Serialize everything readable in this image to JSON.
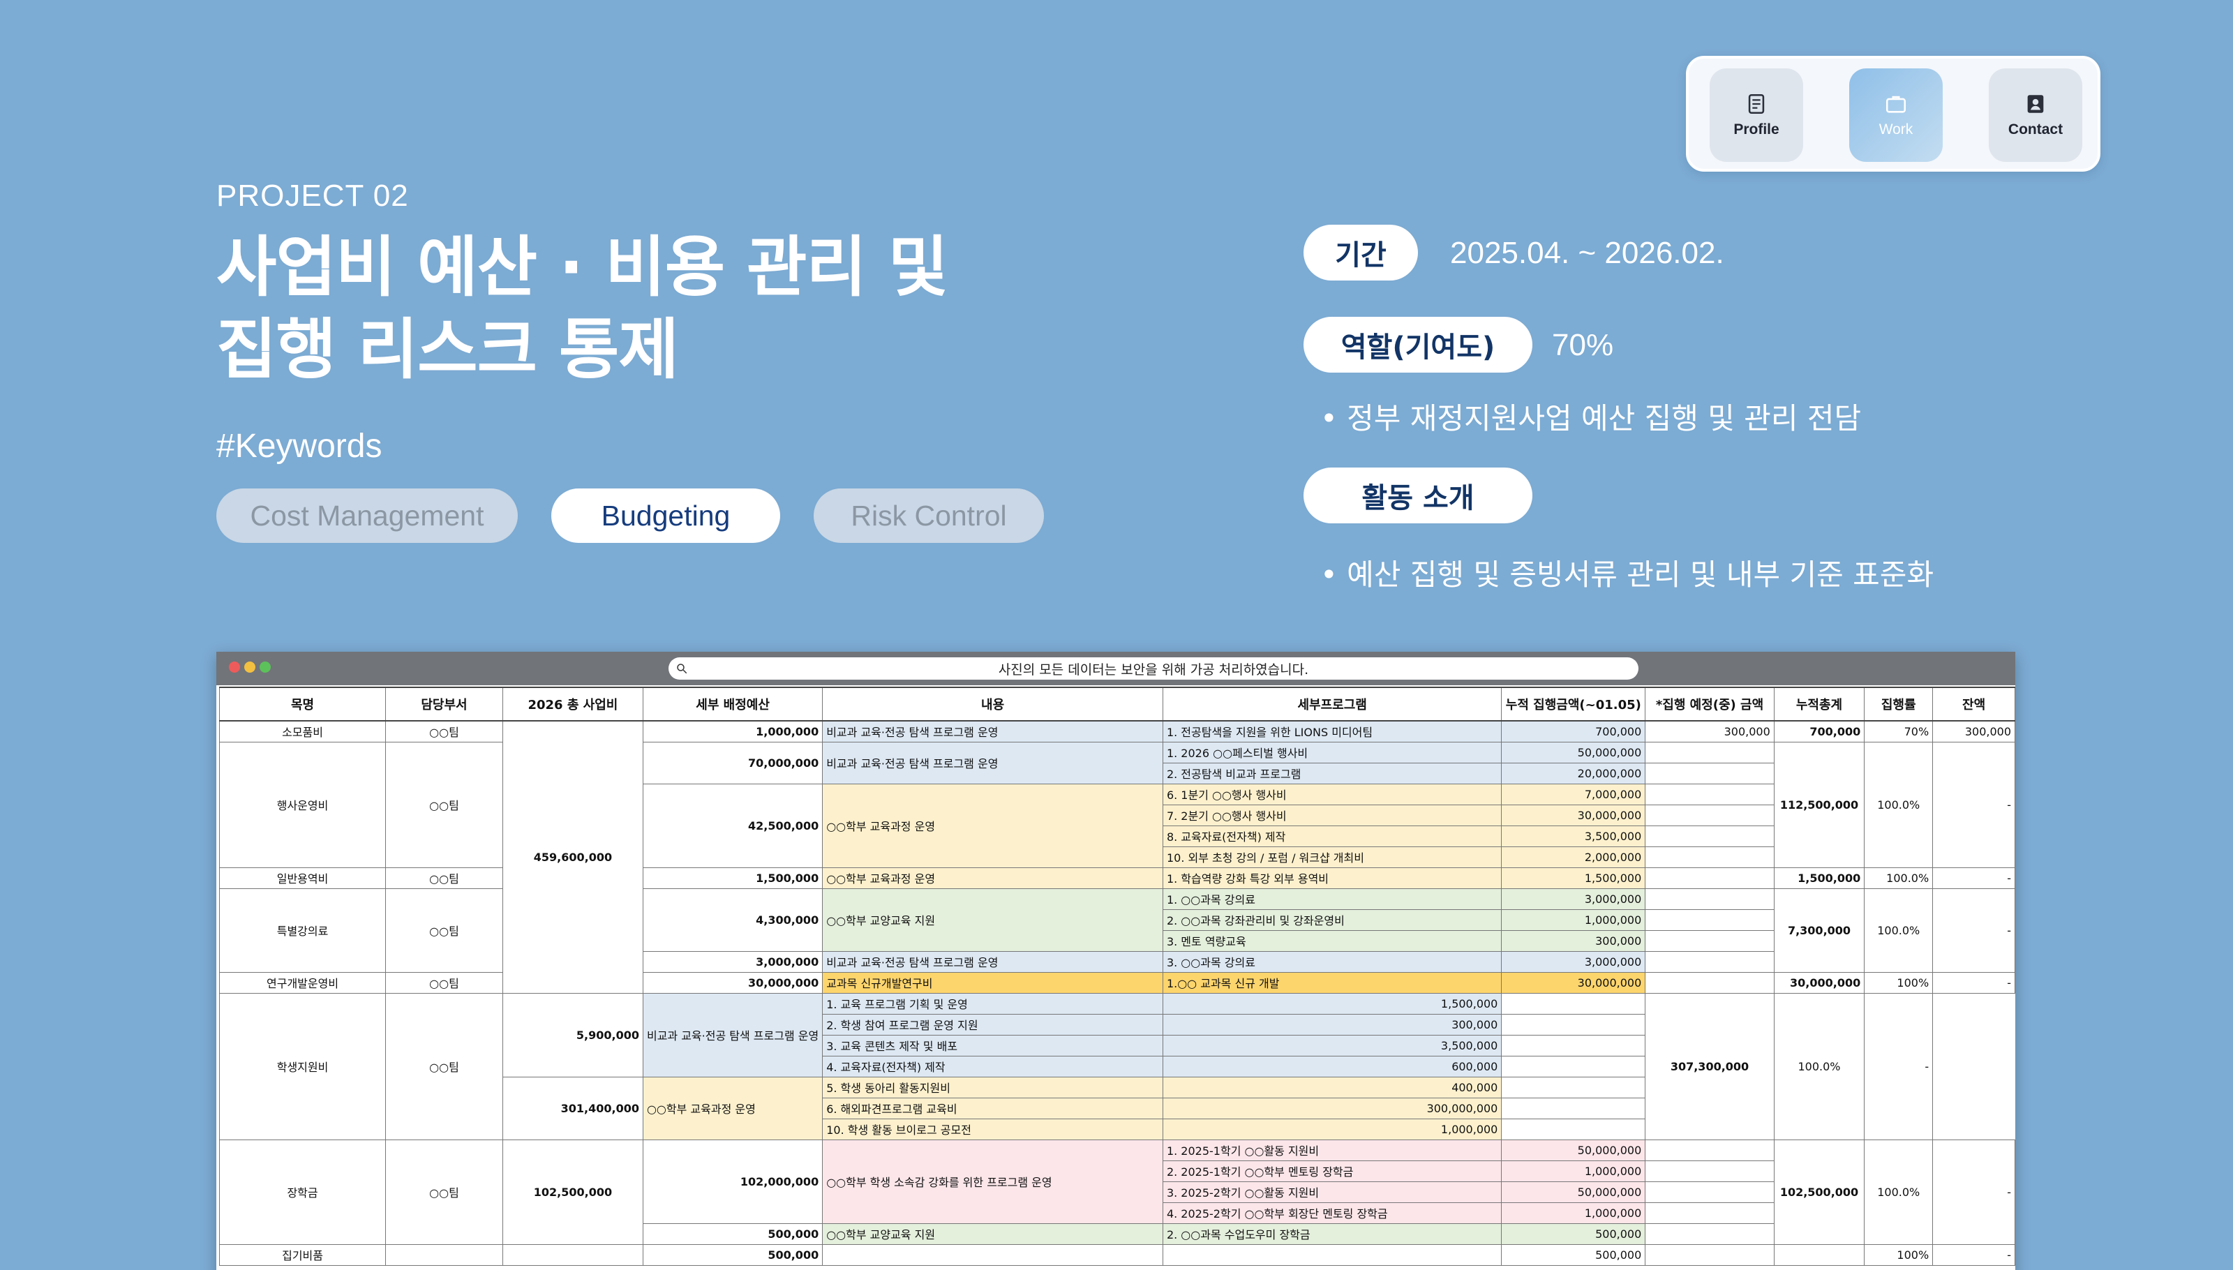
{
  "nav": {
    "items": [
      {
        "label": "Profile",
        "icon": "document-icon",
        "active": false
      },
      {
        "label": "Work",
        "icon": "briefcase-icon",
        "active": true
      },
      {
        "label": "Contact",
        "icon": "contact-book-icon",
        "active": false
      }
    ]
  },
  "header": {
    "project": "PROJECT 02",
    "title_line1": "사업비 예산 · 비용 관리 및",
    "title_line2": "집행 리스크 통제",
    "keywords_label": "#Keywords",
    "keywords": [
      {
        "label": "Cost Management",
        "selected": false
      },
      {
        "label": "Budgeting",
        "selected": true
      },
      {
        "label": "Risk Control",
        "selected": false
      }
    ]
  },
  "info": {
    "period_label": "기간",
    "period_value": "2025.04. ~ 2026.02.",
    "role_label": "역할(기여도)",
    "role_value": "70%",
    "role_bullet": "정부 재정지원사업 예산 집행 및 관리 전담",
    "activity_label": "활동 소개",
    "activity_bullet": "예산 집행 및 증빙서류 관리 및 내부 기준 표준화"
  },
  "window": {
    "address_text": "사진의 모든 데이터는 보안을 위해 가공 처리하였습니다."
  },
  "sheet": {
    "headers": [
      "목명",
      "담당부서",
      "2026 총 사업비",
      "세부 배정예산",
      "내용",
      "세부프로그램",
      "누적 집행금액(~01.05)",
      "*집행 예정(중) 금액",
      "누적총계",
      "집행률",
      "잔액"
    ],
    "rows": [
      {
        "cells": [
          {
            "t": "소모품비",
            "cls": "c"
          },
          {
            "t": "○○팀",
            "cls": "c"
          },
          {
            "t": "459,600,000",
            "rs": 13,
            "cls": "c b"
          },
          {
            "t": "1,000,000",
            "cls": "r b"
          },
          {
            "t": "비교과 교육·전공 탐색 프로그램 운영",
            "cls": "bl"
          },
          {
            "t": "1. 전공탐색을 지원을 위한 LIONS 미디어팀",
            "cls": "bl"
          },
          {
            "t": "700,000",
            "cls": "r bl"
          },
          {
            "t": "300,000",
            "cls": "r"
          },
          {
            "t": "700,000",
            "cls": "r b"
          },
          {
            "t": "70%",
            "cls": "r"
          },
          {
            "t": "300,000",
            "cls": "r"
          }
        ]
      },
      {
        "cells": [
          {
            "t": "행사운영비",
            "rs": 6,
            "cls": "c"
          },
          {
            "t": "○○팀",
            "rs": 6,
            "cls": "c"
          },
          {
            "t": "70,000,000",
            "rs": 2,
            "cls": "r b"
          },
          {
            "t": "비교과 교육·전공 탐색 프로그램 운영",
            "rs": 2,
            "cls": "bl"
          },
          {
            "t": "1. 2026 ○○페스티벌 행사비",
            "cls": "bl"
          },
          {
            "t": "50,000,000",
            "cls": "r bl"
          },
          {
            "t": "",
            "cls": ""
          },
          {
            "t": "112,500,000",
            "rs": 6,
            "cls": "c b"
          },
          {
            "t": "100.0%",
            "rs": 6,
            "cls": "c"
          },
          {
            "t": "-",
            "rs": 6,
            "cls": "r"
          }
        ]
      },
      {
        "cells": [
          {
            "t": "2. 전공탐색 비교과 프로그램",
            "cls": "bl"
          },
          {
            "t": "20,000,000",
            "cls": "r bl"
          },
          {
            "t": "",
            "cls": ""
          }
        ]
      },
      {
        "cells": [
          {
            "t": "42,500,000",
            "rs": 4,
            "cls": "r b"
          },
          {
            "t": "○○학부 교육과정 운영",
            "rs": 4,
            "cls": "ye"
          },
          {
            "t": "6. 1분기 ○○행사 행사비",
            "cls": "ye"
          },
          {
            "t": "7,000,000",
            "cls": "r ye"
          },
          {
            "t": "",
            "cls": ""
          }
        ]
      },
      {
        "cells": [
          {
            "t": "7. 2분기 ○○행사 행사비",
            "cls": "ye"
          },
          {
            "t": "30,000,000",
            "cls": "r ye"
          },
          {
            "t": "",
            "cls": ""
          }
        ]
      },
      {
        "cells": [
          {
            "t": "8. 교육자료(전자책) 제작",
            "cls": "ye"
          },
          {
            "t": "3,500,000",
            "cls": "r ye"
          },
          {
            "t": "",
            "cls": ""
          }
        ]
      },
      {
        "cells": [
          {
            "t": "10. 외부 초청 강의 / 포럼 / 워크샵 개최비",
            "cls": "ye"
          },
          {
            "t": "2,000,000",
            "cls": "r ye"
          },
          {
            "t": "",
            "cls": ""
          }
        ]
      },
      {
        "cells": [
          {
            "t": "일반용역비",
            "cls": "c"
          },
          {
            "t": "○○팀",
            "cls": "c"
          },
          {
            "t": "1,500,000",
            "cls": "r b"
          },
          {
            "t": "○○학부 교육과정 운영",
            "cls": "ye"
          },
          {
            "t": "1. 학습역량 강화 특강 외부 용역비",
            "cls": "ye"
          },
          {
            "t": "1,500,000",
            "cls": "r ye"
          },
          {
            "t": "",
            "cls": ""
          },
          {
            "t": "1,500,000",
            "cls": "r b"
          },
          {
            "t": "100.0%",
            "cls": "r"
          },
          {
            "t": "-",
            "cls": "r"
          }
        ]
      },
      {
        "cells": [
          {
            "t": "특별강의료",
            "rs": 4,
            "cls": "c"
          },
          {
            "t": "○○팀",
            "rs": 4,
            "cls": "c"
          },
          {
            "t": "4,300,000",
            "rs": 3,
            "cls": "r b"
          },
          {
            "t": "○○학부 교양교육 지원",
            "rs": 3,
            "cls": "gr"
          },
          {
            "t": "1. ○○과목 강의료",
            "cls": "gr"
          },
          {
            "t": "3,000,000",
            "cls": "r gr"
          },
          {
            "t": "",
            "cls": ""
          },
          {
            "t": "7,300,000",
            "rs": 4,
            "cls": "c b"
          },
          {
            "t": "100.0%",
            "rs": 4,
            "cls": "c"
          },
          {
            "t": "-",
            "rs": 4,
            "cls": "r"
          }
        ]
      },
      {
        "cells": [
          {
            "t": "2. ○○과목 강좌관리비 및 강좌운영비",
            "cls": "gr"
          },
          {
            "t": "1,000,000",
            "cls": "r gr"
          },
          {
            "t": "",
            "cls": ""
          }
        ]
      },
      {
        "cells": [
          {
            "t": "3. 멘토 역량교육",
            "cls": "gr"
          },
          {
            "t": "300,000",
            "cls": "r gr"
          },
          {
            "t": "",
            "cls": ""
          }
        ]
      },
      {
        "cells": [
          {
            "t": "3,000,000",
            "cls": "r b"
          },
          {
            "t": "비교과 교육·전공 탐색 프로그램 운영",
            "cls": "bl"
          },
          {
            "t": "3. ○○과목 강의료",
            "cls": "bl"
          },
          {
            "t": "3,000,000",
            "cls": "r bl"
          },
          {
            "t": "",
            "cls": ""
          }
        ]
      },
      {
        "cells": [
          {
            "t": "연구개발운영비",
            "cls": "c"
          },
          {
            "t": "○○팀",
            "cls": "c"
          },
          {
            "t": "30,000,000",
            "cls": "r b"
          },
          {
            "t": "교과목 신규개발연구비",
            "cls": "or"
          },
          {
            "t": "1.○○ 교과목 신규 개발",
            "cls": "or"
          },
          {
            "t": "30,000,000",
            "cls": "r or"
          },
          {
            "t": "",
            "cls": ""
          },
          {
            "t": "30,000,000",
            "cls": "r b"
          },
          {
            "t": "100%",
            "cls": "r"
          },
          {
            "t": "-",
            "cls": "r"
          }
        ]
      },
      {
        "cells": [
          {
            "t": "학생지원비",
            "rs": 7,
            "cls": "c"
          },
          {
            "t": "○○팀",
            "rs": 7,
            "cls": "c"
          },
          {
            "t": "5,900,000",
            "rs": 4,
            "cls": "r b"
          },
          {
            "t": "비교과 교육·전공 탐색 프로그램 운영",
            "rs": 4,
            "cls": "bl"
          },
          {
            "t": "1. 교육 프로그램 기획 및 운영",
            "cls": "bl"
          },
          {
            "t": "1,500,000",
            "cls": "r bl"
          },
          {
            "t": "",
            "cls": ""
          },
          {
            "t": "307,300,000",
            "rs": 7,
            "cls": "c b"
          },
          {
            "t": "100.0%",
            "rs": 7,
            "cls": "c"
          },
          {
            "t": "-",
            "rs": 7,
            "cls": "r"
          }
        ]
      },
      {
        "cells": [
          {
            "t": "2. 학생 참여 프로그램 운영 지원",
            "cls": "bl"
          },
          {
            "t": "300,000",
            "cls": "r bl"
          },
          {
            "t": "",
            "cls": ""
          }
        ]
      },
      {
        "cells": [
          {
            "t": "3. 교육 콘텐츠 제작 및 배포",
            "cls": "bl"
          },
          {
            "t": "3,500,000",
            "cls": "r bl"
          },
          {
            "t": "",
            "cls": ""
          }
        ]
      },
      {
        "cells": [
          {
            "t": "4. 교육자료(전자책) 제작",
            "cls": "bl"
          },
          {
            "t": "600,000",
            "cls": "r bl"
          },
          {
            "t": "",
            "cls": ""
          }
        ]
      },
      {
        "cells": [
          {
            "t": "301,400,000",
            "rs": 3,
            "cls": "r b"
          },
          {
            "t": "○○학부 교육과정 운영",
            "rs": 3,
            "cls": "ye"
          },
          {
            "t": "5. 학생 동아리 활동지원비",
            "cls": "ye"
          },
          {
            "t": "400,000",
            "cls": "r ye"
          },
          {
            "t": "",
            "cls": ""
          }
        ]
      },
      {
        "cells": [
          {
            "t": "6. 해외파견프로그램 교육비",
            "cls": "ye"
          },
          {
            "t": "300,000,000",
            "cls": "r ye"
          },
          {
            "t": "",
            "cls": ""
          }
        ]
      },
      {
        "cells": [
          {
            "t": "10. 학생 활동 브이로그 공모전",
            "cls": "ye"
          },
          {
            "t": "1,000,000",
            "cls": "r ye"
          },
          {
            "t": "",
            "cls": ""
          }
        ]
      },
      {
        "cells": [
          {
            "t": "장학금",
            "rs": 5,
            "cls": "c"
          },
          {
            "t": "○○팀",
            "rs": 5,
            "cls": "c"
          },
          {
            "t": "102,500,000",
            "rs": 5,
            "cls": "c b"
          },
          {
            "t": "102,000,000",
            "rs": 4,
            "cls": "r b"
          },
          {
            "t": "○○학부 학생 소속감 강화를 위한 프로그램 운영",
            "rs": 4,
            "cls": "pk"
          },
          {
            "t": "1. 2025-1학기 ○○활동 지원비",
            "cls": "pk"
          },
          {
            "t": "50,000,000",
            "cls": "r pk"
          },
          {
            "t": "",
            "cls": ""
          },
          {
            "t": "102,500,000",
            "rs": 5,
            "cls": "c b"
          },
          {
            "t": "100.0%",
            "rs": 5,
            "cls": "c"
          },
          {
            "t": "-",
            "rs": 5,
            "cls": "r"
          }
        ]
      },
      {
        "cells": [
          {
            "t": "2. 2025-1학기 ○○학부 멘토링 장학금",
            "cls": "pk"
          },
          {
            "t": "1,000,000",
            "cls": "r pk"
          },
          {
            "t": "",
            "cls": ""
          }
        ]
      },
      {
        "cells": [
          {
            "t": "3. 2025-2학기 ○○활동 지원비",
            "cls": "pk"
          },
          {
            "t": "50,000,000",
            "cls": "r pk"
          },
          {
            "t": "",
            "cls": ""
          }
        ]
      },
      {
        "cells": [
          {
            "t": "4. 2025-2학기 ○○학부 회장단 멘토링 장학금",
            "cls": "pk"
          },
          {
            "t": "1,000,000",
            "cls": "r pk"
          },
          {
            "t": "",
            "cls": ""
          }
        ]
      },
      {
        "cells": [
          {
            "t": "500,000",
            "cls": "r b"
          },
          {
            "t": "○○학부 교양교육 지원",
            "cls": "gr"
          },
          {
            "t": "2. ○○과목 수업도우미 장학금",
            "cls": "gr"
          },
          {
            "t": "500,000",
            "cls": "r gr"
          },
          {
            "t": "",
            "cls": ""
          }
        ]
      },
      {
        "cells": [
          {
            "t": "집기비품",
            "cls": "c"
          },
          {
            "t": "",
            "cls": ""
          },
          {
            "t": "",
            "cls": ""
          },
          {
            "t": "500,000",
            "cls": "r b"
          },
          {
            "t": "",
            "cls": ""
          },
          {
            "t": "",
            "cls": ""
          },
          {
            "t": "500,000",
            "cls": "r"
          },
          {
            "t": "",
            "cls": ""
          },
          {
            "t": "",
            "cls": ""
          },
          {
            "t": "100%",
            "cls": "r"
          },
          {
            "t": "-",
            "cls": "r"
          }
        ]
      }
    ]
  },
  "colors": {
    "background": "#7cabd3",
    "accent_text": "#163c7d",
    "row_blue": "#dde8f3",
    "row_yellow": "#fdf1cd",
    "row_green": "#e4efdc",
    "row_pink": "#fce6ea",
    "row_orange": "#fdd56d"
  }
}
